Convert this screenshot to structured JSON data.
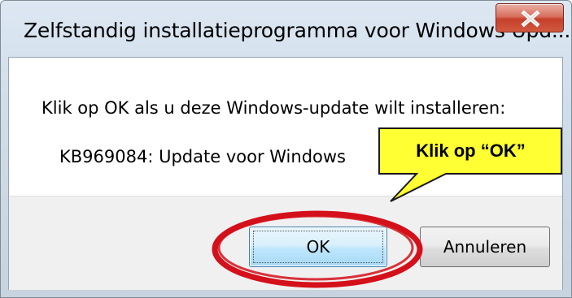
{
  "window": {
    "title": "Zelfstandig installatieprogramma voor Windows Upd...",
    "close_symbol": "X"
  },
  "dialog": {
    "message": "Klik op OK als u deze Windows-update wilt installeren:",
    "update_name": "KB969084: Update voor Windows",
    "ok_label": "OK",
    "cancel_label": "Annuleren"
  },
  "annotation": {
    "callout_text": "Klik op “OK”",
    "callout_fill": "#ffff33",
    "highlight_color": "#d4101a"
  },
  "icons": {
    "close": "close-icon"
  }
}
